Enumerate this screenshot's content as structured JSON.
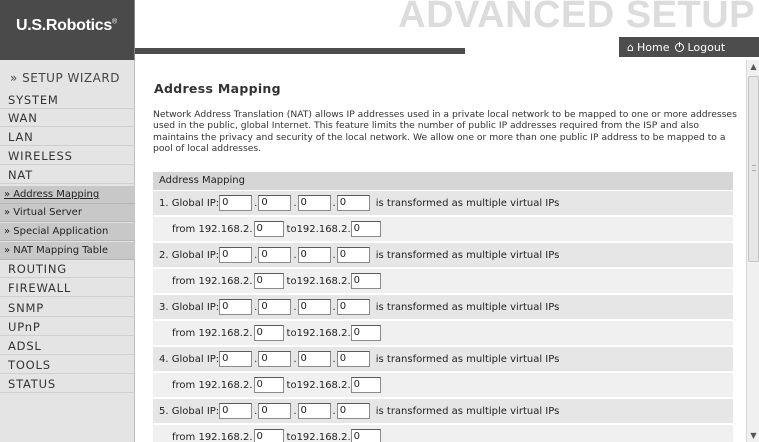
{
  "header": {
    "logo": "U.S.Robotics",
    "logo_mark": "®",
    "title": "ADVANCED SETUP",
    "home_label": "Home",
    "logout_label": "Logout"
  },
  "sidebar": {
    "wizard": "» SETUP WIZARD",
    "items_top": [
      "SYSTEM",
      "WAN",
      "LAN",
      "WIRELESS",
      "NAT"
    ],
    "nat_sub": [
      "» Address Mapping",
      "» Virtual Server",
      "» Special Application",
      "» NAT Mapping Table"
    ],
    "items_bottom": [
      "ROUTING",
      "FIREWALL",
      "SNMP",
      "UPnP",
      "ADSL",
      "TOOLS",
      "STATUS"
    ]
  },
  "main": {
    "title": "Address Mapping",
    "description": "Network Address Translation (NAT) allows IP addresses used in a private local network to be mapped to one or more addresses used in the public, global Internet. This feature limits the number of public IP addresses required from the ISP and also maintains the privacy and security of the local network. We allow one or more than one public IP address to be mapped to a pool of local addresses.",
    "table_header": "Address Mapping",
    "global_ip_label": "Global IP:",
    "transform_text": "is transformed as multiple virtual IPs",
    "from_label": "from 192.168.2.",
    "to_label": "to192.168.2.",
    "mappings": [
      {
        "num": "1.",
        "global": [
          "0",
          "0",
          "0",
          "0"
        ],
        "from": "0",
        "to": "0"
      },
      {
        "num": "2.",
        "global": [
          "0",
          "0",
          "0",
          "0"
        ],
        "from": "0",
        "to": "0"
      },
      {
        "num": "3.",
        "global": [
          "0",
          "0",
          "0",
          "0"
        ],
        "from": "0",
        "to": "0"
      },
      {
        "num": "4.",
        "global": [
          "0",
          "0",
          "0",
          "0"
        ],
        "from": "0",
        "to": "0"
      },
      {
        "num": "5.",
        "global": [
          "0",
          "0",
          "0",
          "0"
        ],
        "from": "0",
        "to": "0"
      }
    ]
  },
  "colors": {
    "header_dark": "#4a4a4a",
    "sidebar_bg": "#e4e4e4",
    "sub_bg": "#c8c8c8",
    "row_bg": "#e6e6e6",
    "title_watermark": "#dcdcdc"
  }
}
